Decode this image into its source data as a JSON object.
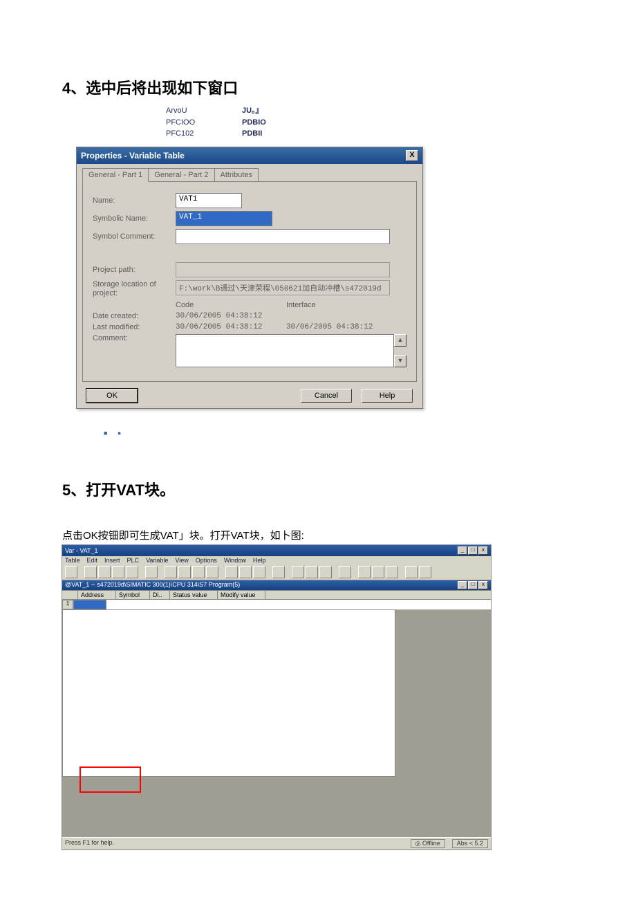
{
  "headings": {
    "h4": "4、选中后将出现如下窗口",
    "h5": "5、打开VAT块。",
    "para": "点击OK按钿即可生成VAT」块。打开VAT块，如卜图:"
  },
  "fragment": {
    "r1c1": "ArvoU",
    "r1c2": "JU。』",
    "r2c1": "PFCIOO",
    "r2c2": "PDBIO",
    "r3c1": "PFC102",
    "r3c2": "PDBII"
  },
  "dialog": {
    "title": "Properties - Variable Table",
    "tabs": {
      "t1": "General - Part 1",
      "t2": "General - Part 2",
      "t3": "Attributes"
    },
    "labels": {
      "name": "Name:",
      "symName": "Symbolic Name:",
      "symComment": "Symbol Comment:",
      "projPath": "Project path:",
      "storage": "Storage location of project:",
      "code": "Code",
      "interface": "Interface",
      "created": "Date created:",
      "modified": "Last modified:",
      "comment": "Comment:"
    },
    "values": {
      "name": "VAT1",
      "symName": "VAT_1",
      "symComment": "",
      "projPath": "",
      "storage": "F:\\work\\B通过\\天津荣程\\050621加自动冲槽\\s472019d",
      "createdCode": "30/06/2005  04:38:12",
      "modifiedCode": "30/06/2005  04:38:12",
      "modifiedInterface": "30/06/2005  04:38:12"
    },
    "buttons": {
      "ok": "OK",
      "cancel": "Cancel",
      "help": "Help"
    }
  },
  "editor": {
    "title": "Var - VAT_1",
    "menu": [
      "Table",
      "Edit",
      "Insert",
      "PLC",
      "Variable",
      "View",
      "Options",
      "Window",
      "Help"
    ],
    "toolbarCount": 23,
    "innerTitle": "@VAT_1 -- s472019d\\SIMATIC 300(1)\\CPU 314\\S7 Program(5)",
    "columns": [
      "",
      "Address",
      "Symbol",
      "Di..",
      "Status value",
      "Modify value"
    ],
    "row1": "1",
    "status": {
      "left": "Press F1 for help.",
      "mode": "◎  Offline",
      "abs": "Abs < 5.2"
    }
  }
}
